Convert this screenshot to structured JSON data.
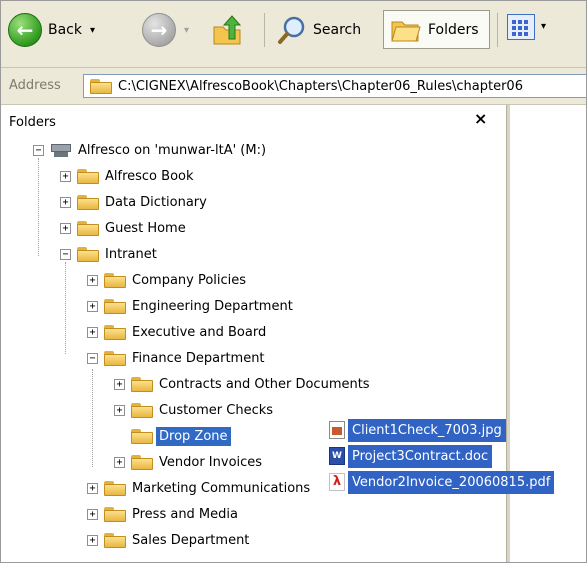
{
  "toolbar": {
    "back_label": "Back",
    "search_label": "Search",
    "folders_label": "Folders",
    "dropdown_glyph": "▾"
  },
  "address": {
    "label": "Address",
    "path": "C:\\CIGNEX\\AlfrescoBook\\Chapters\\Chapter06_Rules\\chapter06"
  },
  "folders_pane": {
    "title": "Folders",
    "close_glyph": "×"
  },
  "tree": {
    "root": "Alfresco on 'munwar-ltA' (M:)",
    "top_level": [
      "Alfresco Book",
      "Data Dictionary",
      "Guest Home",
      "Intranet"
    ],
    "intranet_children": [
      "Company Policies",
      "Engineering Department",
      "Executive and Board",
      "Finance Department"
    ],
    "finance_children": [
      "Contracts and Other Documents",
      "Customer Checks",
      "Drop Zone",
      "Vendor Invoices"
    ],
    "after_finance": [
      "Marketing Communications",
      "Press and Media",
      "Sales Department"
    ]
  },
  "dragged_files": [
    {
      "name": "Client1Check_7003.jpg",
      "icon": "jpg-file-icon"
    },
    {
      "name": "Project3Contract.doc",
      "icon": "word-doc-icon"
    },
    {
      "name": "Vendor2Invoice_20060815.pdf",
      "icon": "pdf-file-icon"
    }
  ],
  "colors": {
    "selection": "#316ac5",
    "toolbar_bg": "#ece9d8"
  }
}
